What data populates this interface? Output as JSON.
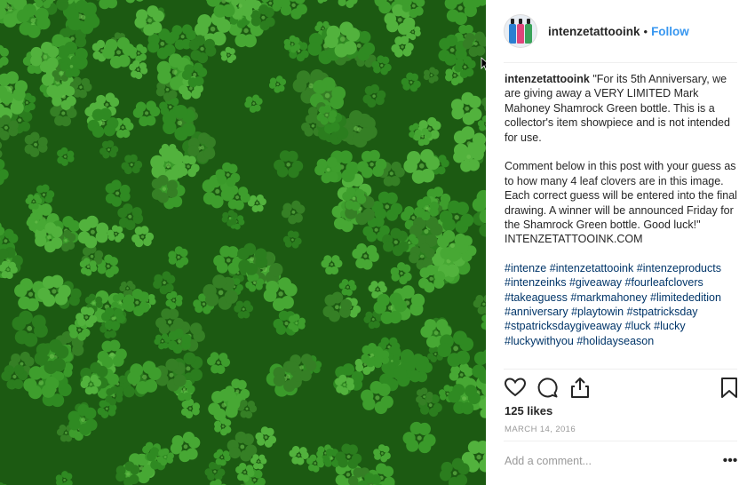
{
  "post": {
    "username": "intenzetattooink",
    "follow_separator": "•",
    "follow_label": "Follow"
  },
  "caption": {
    "username": "intenzetattooink",
    "paragraph1": "\"For its 5th Anniversary, we are giving away a VERY LIMITED Mark Mahoney Shamrock Green bottle. This is a collector's item showpiece and is not intended for use.",
    "paragraph2": "Comment below in this post with your guess as to how many 4 leaf clovers are in this image. Each correct guess will be entered into the final drawing. A winner will be announced Friday for the Shamrock Green bottle. Good luck!\"",
    "website": "INTENZETATTOOINK.COM",
    "hashtags": [
      "#intenze",
      "#intenzetattooink",
      "#intenzeproducts",
      "#intenzeinks",
      "#giveaway",
      "#fourleafclovers",
      "#takeaguess",
      "#markmahoney",
      "#limitededition",
      "#anniversary",
      "#playtowin",
      "#stpatricksday",
      "#stpatricksdaygiveaway",
      "#luck",
      "#lucky",
      "#luckywithyou",
      "#holidayseason"
    ]
  },
  "actions": {
    "like_icon": "heart-icon",
    "comment_icon": "speech-bubble-icon",
    "share_icon": "share-icon",
    "save_icon": "bookmark-icon"
  },
  "likes_text": "125 likes",
  "date_text": "MARCH 14, 2016",
  "comment_placeholder": "Add a comment...",
  "more_label": "•••",
  "colors": {
    "link_blue": "#3897f0",
    "hashtag_blue": "#003569",
    "clover_green": "#3a9a2a"
  }
}
